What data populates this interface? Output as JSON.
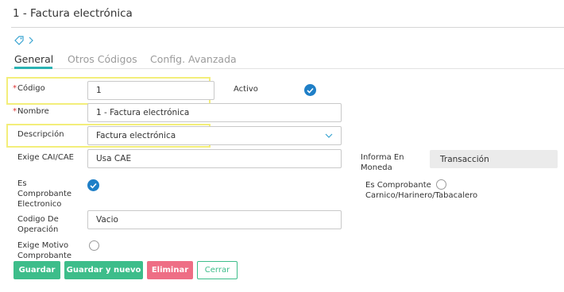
{
  "header": {
    "title": "1 - Factura electrónica"
  },
  "tabs": [
    {
      "label": "General"
    },
    {
      "label": "Otros Códigos"
    },
    {
      "label": "Config. Avanzada"
    }
  ],
  "form": {
    "codigo": {
      "label": "Código",
      "value": "1"
    },
    "activo": {
      "label": "Activo",
      "checked": true
    },
    "nombre": {
      "label": "Nombre",
      "value": "1 - Factura electrónica"
    },
    "descripcion": {
      "label": "Descripción",
      "value": "Factura electrónica"
    },
    "exige_cai": {
      "label": "Exige CAI/CAE",
      "value": "Usa CAE"
    },
    "informa_moneda": {
      "label_line1": "Informa En",
      "label_line2": "Moneda",
      "value": "Transacción"
    },
    "es_comprobante_electronico": {
      "label_line1": "Es",
      "label_line2": "Comprobante",
      "label_line3": "Electronico",
      "checked": true
    },
    "es_comprobante_carnico": {
      "label_line1": "Es Comprobante",
      "label_line2": "Carnico/Harinero/Tabacalero",
      "checked": false
    },
    "codigo_operacion": {
      "label_line1": "Codigo De",
      "label_line2": "Operación",
      "value": "Vacio"
    },
    "exige_motivo": {
      "label_line1": "Exige Motivo",
      "label_line2": "Comprobante",
      "checked": false
    }
  },
  "buttons": {
    "guardar": "Guardar",
    "guardar_nuevo": "Guardar y nuevo",
    "eliminar": "Eliminar",
    "cerrar": "Cerrar"
  },
  "colors": {
    "accent": "#2ab3b3",
    "check": "#1f7fc7",
    "green": "#3dbd8a",
    "red": "#ee6e85",
    "highlight": "#f3ee7a"
  }
}
